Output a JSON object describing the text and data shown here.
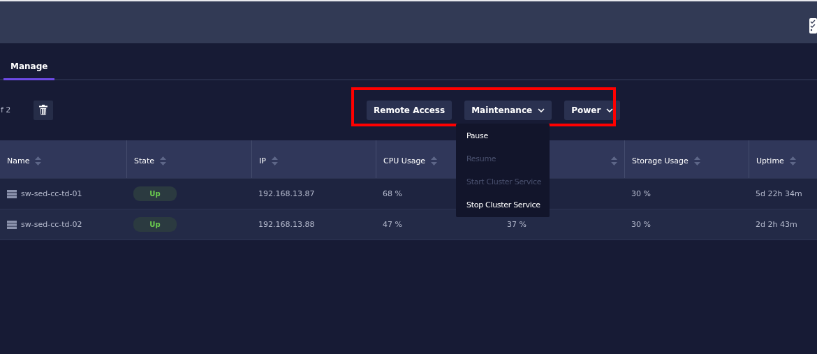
{
  "tabs": [
    {
      "label": "Manage",
      "selected": true
    }
  ],
  "toolbar": {
    "pager_text": "f 2",
    "actions": [
      {
        "label": "Remote Access",
        "dropdown": false
      },
      {
        "label": "Maintenance",
        "dropdown": true
      },
      {
        "label": "Power",
        "dropdown": true
      }
    ]
  },
  "maintenance_menu": [
    {
      "label": "Pause",
      "disabled": false
    },
    {
      "label": "Resume",
      "disabled": true
    },
    {
      "label": "Start Cluster Service",
      "disabled": true
    },
    {
      "label": "Stop Cluster Service",
      "disabled": false
    }
  ],
  "table": {
    "columns": [
      "Name",
      "State",
      "IP",
      "CPU Usage",
      "",
      "Storage Usage",
      "Uptime"
    ],
    "rows": [
      {
        "name": "sw-sed-cc-td-01",
        "state": "Up",
        "ip": "192.168.13.87",
        "cpu": "68 %",
        "column_5": "",
        "storage": "30 %",
        "uptime": "5d 22h 34m"
      },
      {
        "name": "sw-sed-cc-td-02",
        "state": "Up",
        "ip": "192.168.13.88",
        "cpu": "47 %",
        "column_5": "37 %",
        "storage": "30 %",
        "uptime": "2d 2h 43m"
      }
    ]
  }
}
